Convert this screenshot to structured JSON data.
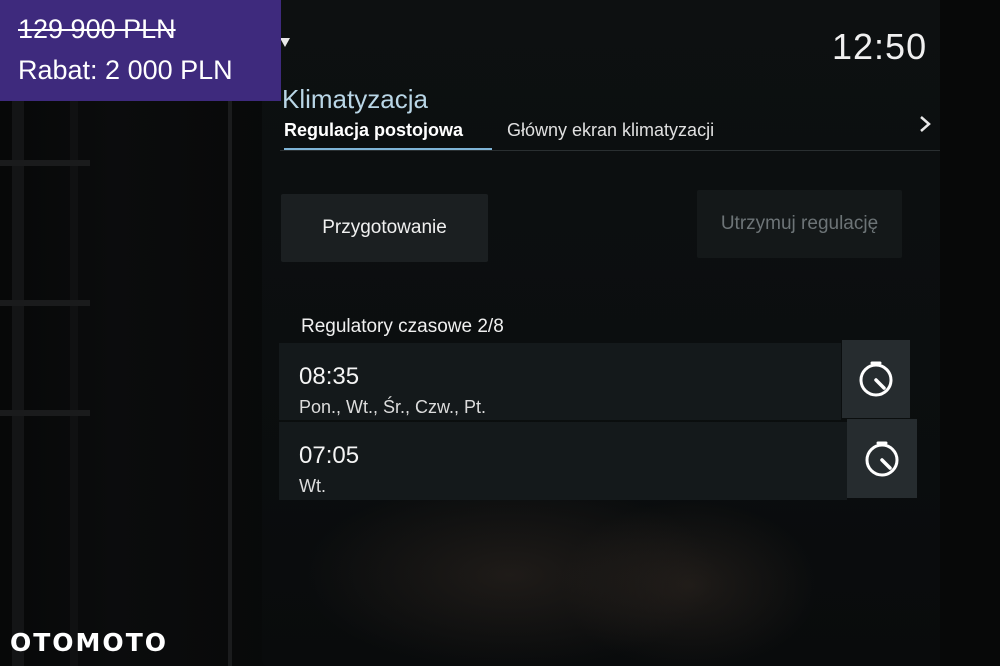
{
  "listing": {
    "old_price": "129 900 PLN",
    "discount": "Rabat: 2 000 PLN",
    "watermark": "OTOMOTO"
  },
  "screen": {
    "status_icon": "signal-triangle-icon",
    "clock": "12:50",
    "app_title": "Klimatyzacja",
    "tabs": [
      {
        "label": "Regulacja postojowa",
        "active": true
      },
      {
        "label": "Główny ekran klimatyzacji",
        "active": false
      }
    ],
    "tabs_more_icon": "chevron-right-icon",
    "buttons": {
      "prep_label": "Przygotowanie",
      "hold_label": "Utrzymuj regulację"
    },
    "timers_title": "Regulatory czasowe 2/8",
    "timers": [
      {
        "time": "08:35",
        "days": "Pon., Wt., Śr., Czw., Pt.",
        "icon": "timer-icon"
      },
      {
        "time": "07:05",
        "days": "Wt.",
        "icon": "timer-icon"
      }
    ]
  },
  "colors": {
    "accent": "#7fb4d6",
    "price_box": "#3e2a7d"
  }
}
